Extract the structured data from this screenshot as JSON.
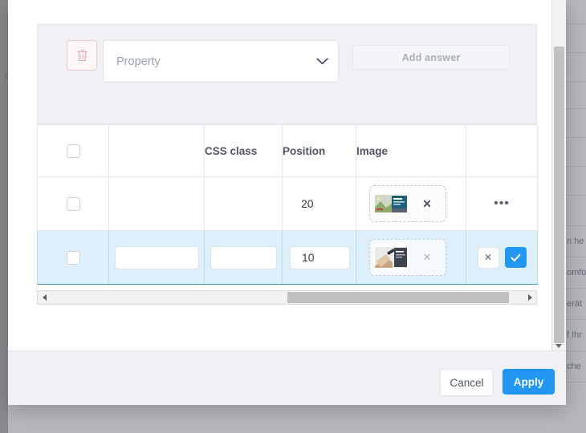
{
  "background": {
    "left_clipped_text": "d",
    "right_rows": [
      "",
      "",
      "",
      "",
      "",
      "",
      "",
      "",
      "n he",
      "omfo",
      "erät",
      "f Ihr",
      "che"
    ]
  },
  "modal": {
    "answer_panel": {
      "delete_icon": "trash-icon",
      "property_select": {
        "placeholder": "Property",
        "value": "",
        "chevron_icon": "chevron-down-icon"
      },
      "add_answer_label": "Add answer"
    },
    "table": {
      "columns": [
        {
          "key": "select",
          "label": ""
        },
        {
          "key": "answer",
          "label": ""
        },
        {
          "key": "css_class",
          "label": "CSS class"
        },
        {
          "key": "position",
          "label": "Position"
        },
        {
          "key": "image",
          "label": "Image"
        },
        {
          "key": "actions",
          "label": ""
        }
      ],
      "header_checkbox_checked": false,
      "rows": [
        {
          "mode": "view",
          "selected": false,
          "checkbox_checked": false,
          "answer": "",
          "css_class": "",
          "position": "20",
          "image": {
            "present": true,
            "remove_label": "✕",
            "alt": "landscape-thumbnail"
          },
          "actions": {
            "menu_label": "•••"
          }
        },
        {
          "mode": "edit",
          "selected": true,
          "checkbox_checked": false,
          "answer": "",
          "answer_placeholder": "",
          "css_class": "",
          "css_placeholder": "",
          "position": "10",
          "image": {
            "present": true,
            "remove_label": "✕",
            "alt": "hands-writing-thumbnail"
          },
          "actions": {
            "cancel_label": "✕",
            "confirm_icon": "check-icon"
          }
        }
      ]
    },
    "hscrollbar": {
      "left_arrow_icon": "caret-left-icon",
      "right_arrow_icon": "caret-right-icon"
    },
    "vscrollbar": {
      "down_arrow_icon": "caret-down-icon"
    },
    "footer": {
      "cancel_label": "Cancel",
      "apply_label": "Apply"
    }
  },
  "colors": {
    "accent": "#2196f3",
    "panel": "#f0f1f5",
    "row_selected": "#ddeffb",
    "row_selected_border": "#3c9ab8",
    "header_text": "#4b5868",
    "muted_text": "#a8afb9",
    "danger": "#f3c6c9"
  }
}
